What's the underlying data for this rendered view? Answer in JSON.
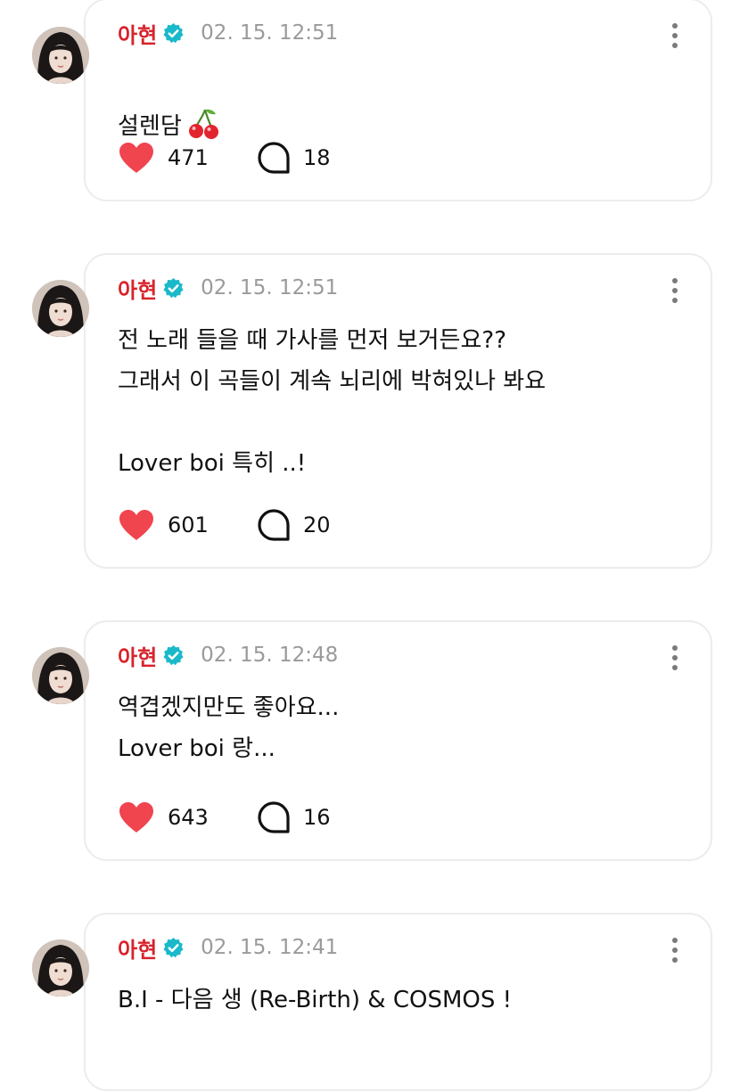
{
  "colors": {
    "author": "#d8232c",
    "verified": "#19b9c9",
    "heart": "#f0444f",
    "time": "#9a9a9a",
    "card_border": "#ececec"
  },
  "posts": [
    {
      "author": "아현",
      "verified_icon": "verified-badge-icon",
      "time": "02. 15. 12:51",
      "text": "설렌담",
      "emoji": "cherry-emoji",
      "likes": "471",
      "comments": "18"
    },
    {
      "author": "아현",
      "verified_icon": "verified-badge-icon",
      "time": "02. 15. 12:51",
      "text": "전 노래 들을 때 가사를 먼저 보거든요??\n그래서 이 곡들이 계속 뇌리에 박혀있나 봐요\n\nLover boi 특히 ..!",
      "likes": "601",
      "comments": "20"
    },
    {
      "author": "아현",
      "verified_icon": "verified-badge-icon",
      "time": "02. 15. 12:48",
      "text": "역겹겠지만도 좋아요...\nLover boi 랑...",
      "likes": "643",
      "comments": "16"
    },
    {
      "author": "아현",
      "verified_icon": "verified-badge-icon",
      "time": "02. 15. 12:41",
      "text": "B.I - 다음 생 (Re-Birth) & COSMOS !"
    }
  ]
}
